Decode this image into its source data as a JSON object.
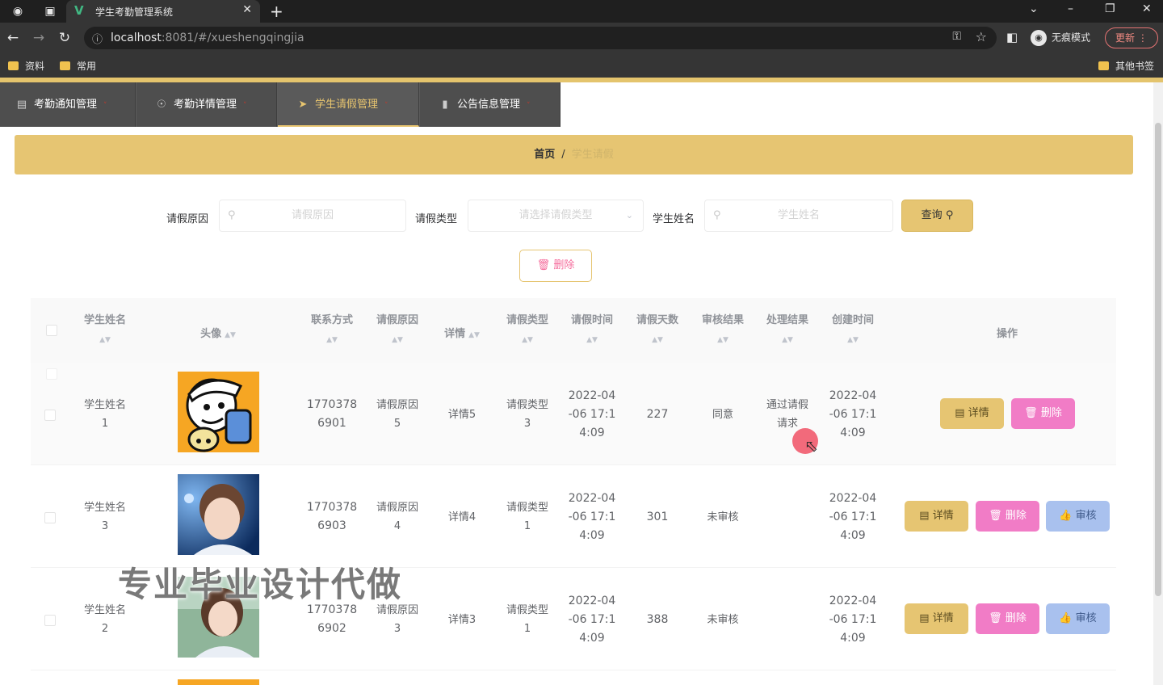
{
  "browser": {
    "tab_title": "学生考勤管理系统",
    "url_host": "localhost",
    "url_rest": ":8081/#/xueshengqingjia",
    "incognito_label": "无痕模式",
    "update_label": "更新",
    "bookmarks": [
      "资料",
      "常用"
    ],
    "other_bookmarks": "其他书签"
  },
  "nav": {
    "items": [
      {
        "label": "考勤通知管理",
        "icon": "clipboard-icon"
      },
      {
        "label": "考勤详情管理",
        "icon": "globe-icon"
      },
      {
        "label": "学生请假管理",
        "icon": "send-icon"
      },
      {
        "label": "公告信息管理",
        "icon": "chart-icon"
      }
    ],
    "active_index": 2
  },
  "breadcrumb": {
    "home": "首页",
    "separator": "/",
    "current": "学生请假"
  },
  "filters": {
    "reason_label": "请假原因",
    "reason_placeholder": "请假原因",
    "type_label": "请假类型",
    "type_placeholder": "请选择请假类型",
    "name_label": "学生姓名",
    "name_placeholder": "学生姓名",
    "query_label": "查询"
  },
  "bulk_delete_label": "删除",
  "table": {
    "headers": {
      "name": "学生姓名",
      "avatar": "头像",
      "phone": "联系方式",
      "reason": "请假原因",
      "detail": "详情",
      "type": "请假类型",
      "time": "请假时间",
      "days": "请假天数",
      "audit": "审核结果",
      "process": "处理结果",
      "created": "创建时间",
      "actions": "操作"
    },
    "rows": [
      {
        "name_line1": "学生姓名",
        "name_line2": "1",
        "phone_line1": "1770378",
        "phone_line2": "6901",
        "reason_line1": "请假原因",
        "reason_line2": "5",
        "detail": "详情5",
        "type_line1": "请假类型",
        "type_line2": "3",
        "time_line1": "2022-04",
        "time_line2": "-06 17:1",
        "time_line3": "4:09",
        "days": "227",
        "audit": "同意",
        "process_line1": "通过请假",
        "process_line2": "请求",
        "created_line1": "2022-04",
        "created_line2": "-06 17:1",
        "created_line3": "4:09"
      },
      {
        "name_line1": "学生姓名",
        "name_line2": "3",
        "phone_line1": "1770378",
        "phone_line2": "6903",
        "reason_line1": "请假原因",
        "reason_line2": "4",
        "detail": "详情4",
        "type_line1": "请假类型",
        "type_line2": "1",
        "time_line1": "2022-04",
        "time_line2": "-06 17:1",
        "time_line3": "4:09",
        "days": "301",
        "audit": "未审核",
        "process_line1": "",
        "process_line2": "",
        "created_line1": "2022-04",
        "created_line2": "-06 17:1",
        "created_line3": "4:09"
      },
      {
        "name_line1": "学生姓名",
        "name_line2": "2",
        "phone_line1": "1770378",
        "phone_line2": "6902",
        "reason_line1": "请假原因",
        "reason_line2": "3",
        "detail": "详情3",
        "type_line1": "请假类型",
        "type_line2": "1",
        "time_line1": "2022-04",
        "time_line2": "-06 17:1",
        "time_line3": "4:09",
        "days": "388",
        "audit": "未审核",
        "process_line1": "",
        "process_line2": "",
        "created_line1": "2022-04",
        "created_line2": "-06 17:1",
        "created_line3": "4:09"
      }
    ]
  },
  "actions": {
    "detail": "详情",
    "delete": "删除",
    "audit": "审核"
  },
  "watermark": "专业毕业设计代做",
  "colors": {
    "accent": "#e6c572",
    "delete": "#f17cc6",
    "audit": "#a9c1ee",
    "nav_bg": "#4e4e4e"
  }
}
